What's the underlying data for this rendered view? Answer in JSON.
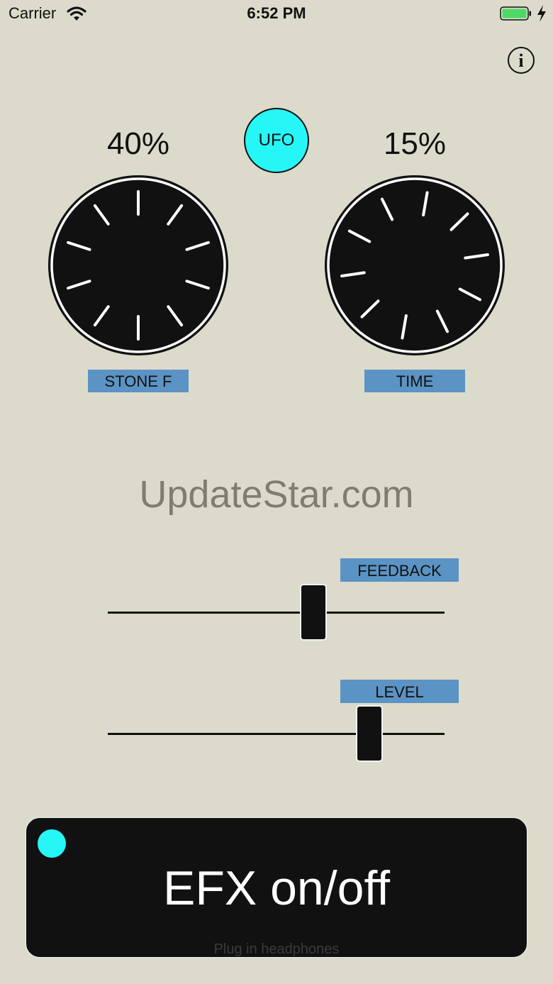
{
  "status_bar": {
    "carrier": "Carrier",
    "time": "6:52 PM"
  },
  "info_button": {
    "label": "i"
  },
  "ufo_button": {
    "label": "UFO",
    "color": "#27f6f7"
  },
  "knobs": [
    {
      "value_text": "40%",
      "label": "STONE F",
      "value": 0.4
    },
    {
      "value_text": "15%",
      "label": "TIME",
      "value": 0.15
    }
  ],
  "watermark": "UpdateStar.com",
  "sliders": [
    {
      "label": "FEEDBACK",
      "value": 0.62
    },
    {
      "label": "LEVEL",
      "value": 0.8
    }
  ],
  "efx_button": {
    "label": "EFX on/off",
    "hint": "Plug in headphones",
    "indicator_color": "#27f6f7"
  },
  "colors": {
    "background": "#dcdbcb",
    "label_bg": "#5b93c4",
    "accent": "#27f6f7"
  }
}
